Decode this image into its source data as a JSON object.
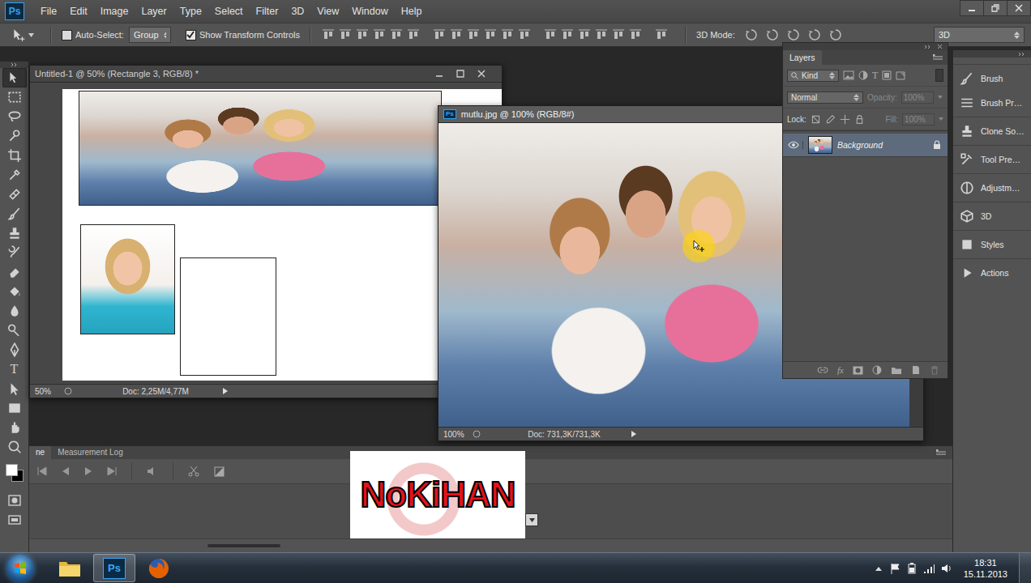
{
  "app": {
    "logo": "Ps"
  },
  "menu": [
    "File",
    "Edit",
    "Image",
    "Layer",
    "Type",
    "Select",
    "Filter",
    "3D",
    "View",
    "Window",
    "Help"
  ],
  "options_bar": {
    "auto_select": {
      "label": "Auto-Select:",
      "checked": false
    },
    "group_select": {
      "value": "Group"
    },
    "transform_controls": {
      "label": "Show Transform Controls",
      "checked": true
    },
    "mode_label": "3D Mode:",
    "workspace": {
      "value": "3D"
    }
  },
  "tools": [
    {
      "kind": "move",
      "selected": true
    },
    {
      "kind": "marquee",
      "selected": false
    },
    {
      "kind": "lasso",
      "selected": false
    },
    {
      "kind": "quick-select",
      "selected": false
    },
    {
      "kind": "crop",
      "selected": false
    },
    {
      "kind": "eyedropper",
      "selected": false
    },
    {
      "kind": "healing",
      "selected": false
    },
    {
      "kind": "brush",
      "selected": false
    },
    {
      "kind": "stamp",
      "selected": false
    },
    {
      "kind": "history-brush",
      "selected": false
    },
    {
      "kind": "eraser",
      "selected": false
    },
    {
      "kind": "bucket",
      "selected": false
    },
    {
      "kind": "blur",
      "selected": false
    },
    {
      "kind": "dodge",
      "selected": false
    },
    {
      "kind": "pen",
      "selected": false
    },
    {
      "kind": "type",
      "glyph": "T",
      "selected": false
    },
    {
      "kind": "path-select",
      "selected": false
    },
    {
      "kind": "rectangle",
      "selected": false
    },
    {
      "kind": "hand",
      "selected": false
    },
    {
      "kind": "zoom",
      "selected": false
    }
  ],
  "swatches": [
    {
      "name": "foreground",
      "color": "#ffffff"
    },
    {
      "name": "background",
      "color": "#000000"
    }
  ],
  "documents": [
    {
      "kind": "composition",
      "title": "Untitled-1 @ 50% (Rectangle 3, RGB/8) *",
      "zoom": "50%",
      "doc_size": "Doc: 2,25M/4,77M",
      "active": false
    },
    {
      "kind": "photo",
      "title": "mutlu.jpg @ 100% (RGB/8#)",
      "zoom": "100%",
      "doc_size": "Doc: 731,3K/731,3K",
      "active": true
    }
  ],
  "layers_panel": {
    "tab": "Layers",
    "filter": "Kind",
    "type_filter_glyph": "T",
    "blend_mode": "Normal",
    "opacity_label": "Opacity:",
    "opacity": "100%",
    "opacity_disabled": true,
    "lock_label": "Lock:",
    "fill_label": "Fill:",
    "fill": "100%",
    "fill_disabled": true,
    "fx_glyph": "fx",
    "layers": [
      {
        "name": "Background",
        "visible": true,
        "locked": true,
        "selected": true
      }
    ]
  },
  "dock": [
    {
      "kind": "brush",
      "label": "Brush"
    },
    {
      "kind": "brush-presets",
      "label": "Brush Pr…"
    },
    {
      "kind": "clone-source",
      "label": "Clone So…"
    },
    {
      "kind": "tool-presets",
      "label": "Tool Pre…"
    },
    {
      "kind": "adjustments",
      "label": "Adjustm…"
    },
    {
      "kind": "3d",
      "label": "3D"
    },
    {
      "kind": "styles",
      "label": "Styles"
    },
    {
      "kind": "actions",
      "label": "Actions"
    }
  ],
  "bottom_panel": {
    "tabs": [
      {
        "label": "ne",
        "selected": true
      },
      {
        "label": "Measurement Log",
        "selected": false
      }
    ]
  },
  "watermark": {
    "text": "NoKiHAN"
  },
  "taskbar": {
    "apps": [
      {
        "kind": "explorer",
        "selected": false
      },
      {
        "kind": "photoshop",
        "label": "Ps",
        "selected": true
      },
      {
        "kind": "firefox",
        "selected": false
      }
    ],
    "time": "18:31",
    "date": "15.11.2013"
  }
}
